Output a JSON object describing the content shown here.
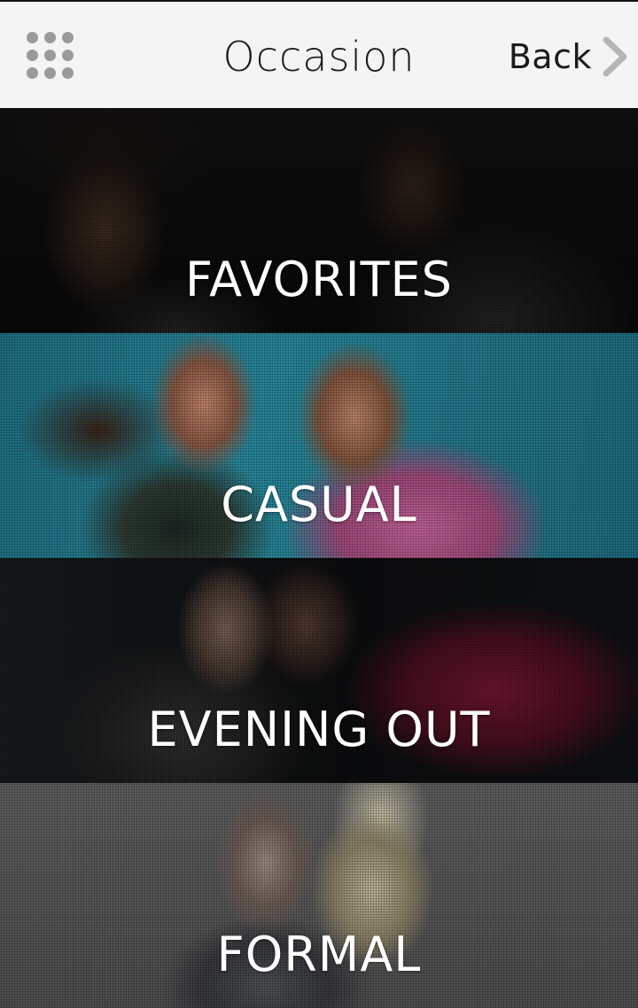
{
  "header": {
    "title": "Occasion",
    "back_label": "Back"
  },
  "occasions": [
    {
      "label": "FAVORITES"
    },
    {
      "label": "CASUAL"
    },
    {
      "label": "EVENING OUT"
    },
    {
      "label": "FORMAL"
    }
  ],
  "colors": {
    "header_bg": "#f4f4f4",
    "header_text": "#1b1b1b",
    "icon_gray": "#9a9a9a",
    "tile_label": "#ffffff"
  },
  "icons": {
    "menu": "grid-menu-icon",
    "back": "chevron-right-icon"
  }
}
